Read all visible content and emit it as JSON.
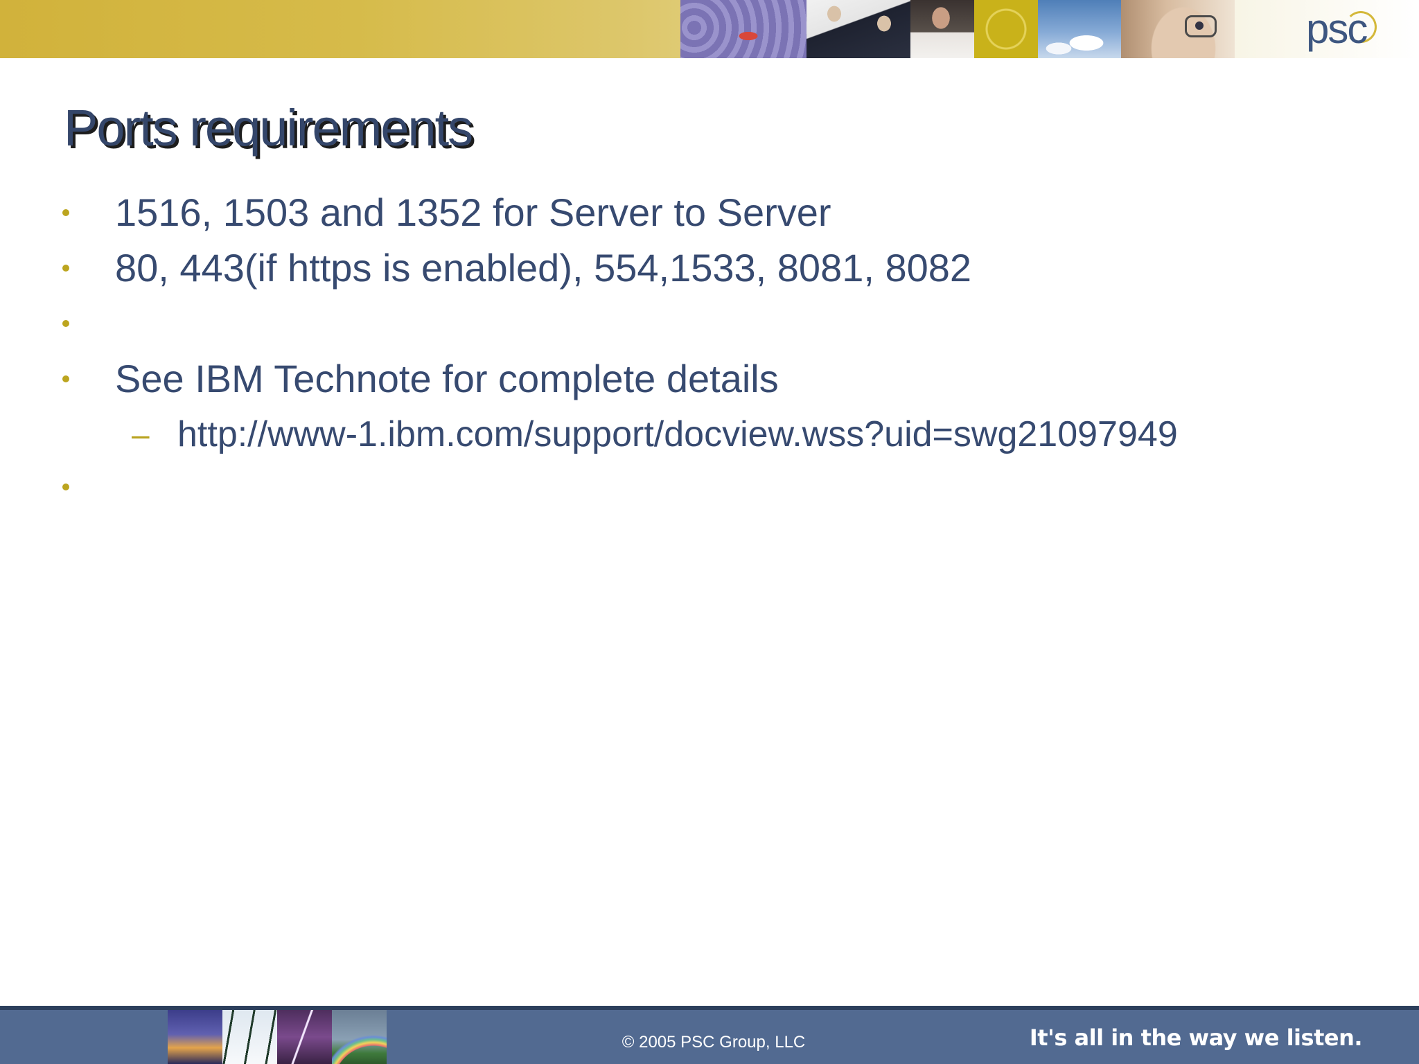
{
  "slide": {
    "title": "Ports requirements",
    "bullets": [
      {
        "level": 1,
        "text": "1516, 1503 and 1352 for Server to Server"
      },
      {
        "level": 1,
        "text": "80, 443(if https is enabled), 554,1533, 8081, 8082"
      },
      {
        "level": 1,
        "text": ""
      },
      {
        "level": 1,
        "text": "See IBM Technote for complete details"
      },
      {
        "level": 2,
        "text": "http://www-1.ibm.com/support/docview.wss?uid=swg21097949"
      },
      {
        "level": 1,
        "text": ""
      }
    ]
  },
  "header": {
    "logo_text": "psc"
  },
  "footer": {
    "copyright": "© 2005 PSC Group, LLC",
    "tagline": "It's all in the way we listen."
  },
  "colors": {
    "title_text": "#34466a",
    "body_text": "#374a70",
    "bullet_accent": "#b8a21e",
    "header_gold": "#d1b23b",
    "footer_blue": "#526a91"
  }
}
